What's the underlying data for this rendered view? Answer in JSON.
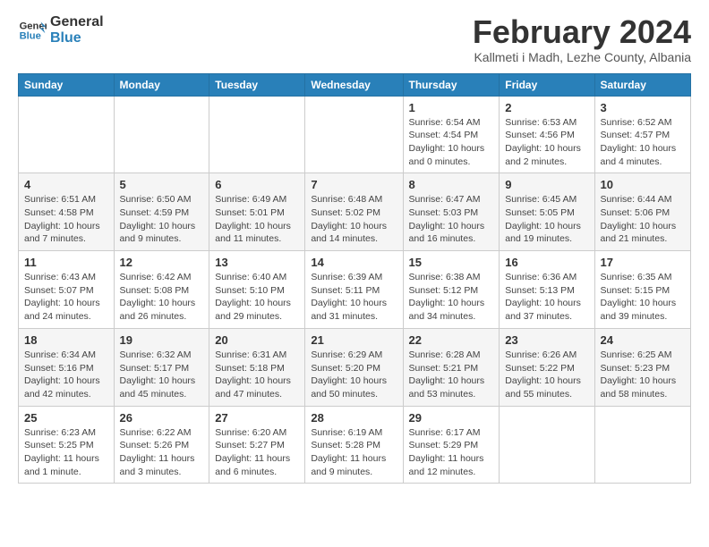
{
  "logo": {
    "line1": "General",
    "line2": "Blue"
  },
  "title": "February 2024",
  "subtitle": "Kallmeti i Madh, Lezhe County, Albania",
  "days_of_week": [
    "Sunday",
    "Monday",
    "Tuesday",
    "Wednesday",
    "Thursday",
    "Friday",
    "Saturday"
  ],
  "weeks": [
    [
      {
        "day": "",
        "info": ""
      },
      {
        "day": "",
        "info": ""
      },
      {
        "day": "",
        "info": ""
      },
      {
        "day": "",
        "info": ""
      },
      {
        "day": "1",
        "info": "Sunrise: 6:54 AM\nSunset: 4:54 PM\nDaylight: 10 hours\nand 0 minutes."
      },
      {
        "day": "2",
        "info": "Sunrise: 6:53 AM\nSunset: 4:56 PM\nDaylight: 10 hours\nand 2 minutes."
      },
      {
        "day": "3",
        "info": "Sunrise: 6:52 AM\nSunset: 4:57 PM\nDaylight: 10 hours\nand 4 minutes."
      }
    ],
    [
      {
        "day": "4",
        "info": "Sunrise: 6:51 AM\nSunset: 4:58 PM\nDaylight: 10 hours\nand 7 minutes."
      },
      {
        "day": "5",
        "info": "Sunrise: 6:50 AM\nSunset: 4:59 PM\nDaylight: 10 hours\nand 9 minutes."
      },
      {
        "day": "6",
        "info": "Sunrise: 6:49 AM\nSunset: 5:01 PM\nDaylight: 10 hours\nand 11 minutes."
      },
      {
        "day": "7",
        "info": "Sunrise: 6:48 AM\nSunset: 5:02 PM\nDaylight: 10 hours\nand 14 minutes."
      },
      {
        "day": "8",
        "info": "Sunrise: 6:47 AM\nSunset: 5:03 PM\nDaylight: 10 hours\nand 16 minutes."
      },
      {
        "day": "9",
        "info": "Sunrise: 6:45 AM\nSunset: 5:05 PM\nDaylight: 10 hours\nand 19 minutes."
      },
      {
        "day": "10",
        "info": "Sunrise: 6:44 AM\nSunset: 5:06 PM\nDaylight: 10 hours\nand 21 minutes."
      }
    ],
    [
      {
        "day": "11",
        "info": "Sunrise: 6:43 AM\nSunset: 5:07 PM\nDaylight: 10 hours\nand 24 minutes."
      },
      {
        "day": "12",
        "info": "Sunrise: 6:42 AM\nSunset: 5:08 PM\nDaylight: 10 hours\nand 26 minutes."
      },
      {
        "day": "13",
        "info": "Sunrise: 6:40 AM\nSunset: 5:10 PM\nDaylight: 10 hours\nand 29 minutes."
      },
      {
        "day": "14",
        "info": "Sunrise: 6:39 AM\nSunset: 5:11 PM\nDaylight: 10 hours\nand 31 minutes."
      },
      {
        "day": "15",
        "info": "Sunrise: 6:38 AM\nSunset: 5:12 PM\nDaylight: 10 hours\nand 34 minutes."
      },
      {
        "day": "16",
        "info": "Sunrise: 6:36 AM\nSunset: 5:13 PM\nDaylight: 10 hours\nand 37 minutes."
      },
      {
        "day": "17",
        "info": "Sunrise: 6:35 AM\nSunset: 5:15 PM\nDaylight: 10 hours\nand 39 minutes."
      }
    ],
    [
      {
        "day": "18",
        "info": "Sunrise: 6:34 AM\nSunset: 5:16 PM\nDaylight: 10 hours\nand 42 minutes."
      },
      {
        "day": "19",
        "info": "Sunrise: 6:32 AM\nSunset: 5:17 PM\nDaylight: 10 hours\nand 45 minutes."
      },
      {
        "day": "20",
        "info": "Sunrise: 6:31 AM\nSunset: 5:18 PM\nDaylight: 10 hours\nand 47 minutes."
      },
      {
        "day": "21",
        "info": "Sunrise: 6:29 AM\nSunset: 5:20 PM\nDaylight: 10 hours\nand 50 minutes."
      },
      {
        "day": "22",
        "info": "Sunrise: 6:28 AM\nSunset: 5:21 PM\nDaylight: 10 hours\nand 53 minutes."
      },
      {
        "day": "23",
        "info": "Sunrise: 6:26 AM\nSunset: 5:22 PM\nDaylight: 10 hours\nand 55 minutes."
      },
      {
        "day": "24",
        "info": "Sunrise: 6:25 AM\nSunset: 5:23 PM\nDaylight: 10 hours\nand 58 minutes."
      }
    ],
    [
      {
        "day": "25",
        "info": "Sunrise: 6:23 AM\nSunset: 5:25 PM\nDaylight: 11 hours\nand 1 minute."
      },
      {
        "day": "26",
        "info": "Sunrise: 6:22 AM\nSunset: 5:26 PM\nDaylight: 11 hours\nand 3 minutes."
      },
      {
        "day": "27",
        "info": "Sunrise: 6:20 AM\nSunset: 5:27 PM\nDaylight: 11 hours\nand 6 minutes."
      },
      {
        "day": "28",
        "info": "Sunrise: 6:19 AM\nSunset: 5:28 PM\nDaylight: 11 hours\nand 9 minutes."
      },
      {
        "day": "29",
        "info": "Sunrise: 6:17 AM\nSunset: 5:29 PM\nDaylight: 11 hours\nand 12 minutes."
      },
      {
        "day": "",
        "info": ""
      },
      {
        "day": "",
        "info": ""
      }
    ]
  ]
}
